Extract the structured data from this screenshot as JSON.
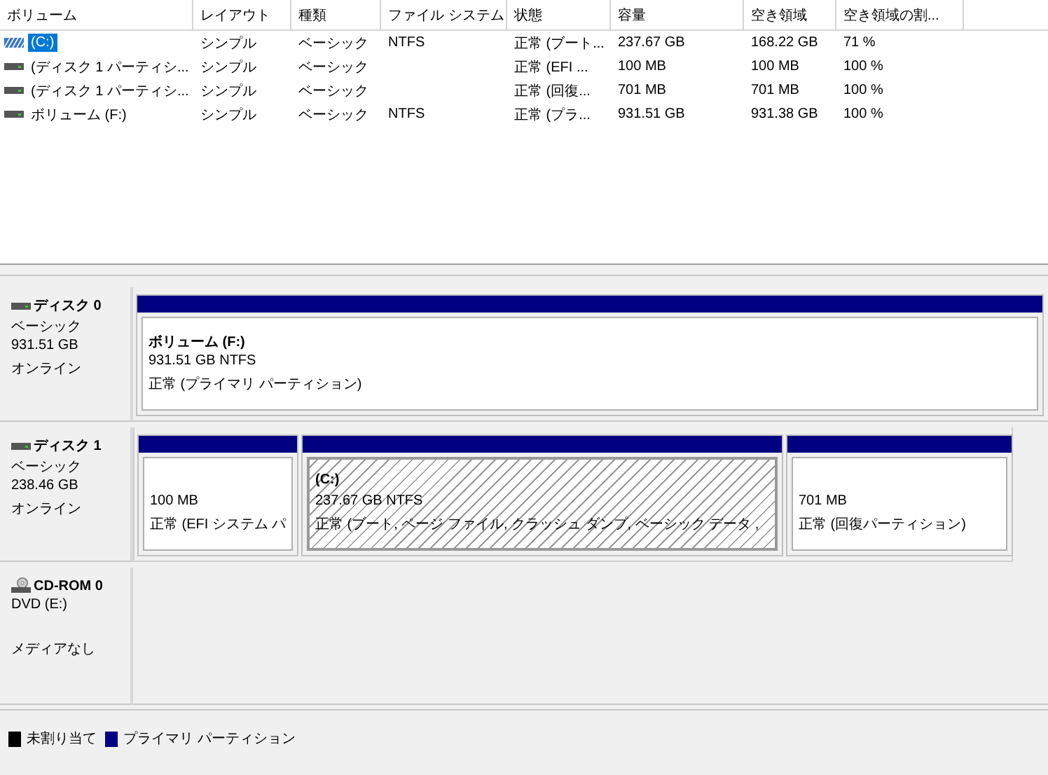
{
  "table": {
    "columns": [
      "ボリューム",
      "レイアウト",
      "種類",
      "ファイル システム",
      "状態",
      "容量",
      "空き領域",
      "空き領域の割..."
    ],
    "rows": [
      {
        "kind": "system",
        "selected": true,
        "cells": [
          "(C:)",
          "シンプル",
          "ベーシック",
          "NTFS",
          "正常 (ブート...",
          "237.67 GB",
          "168.22 GB",
          "71 %"
        ]
      },
      {
        "kind": "data",
        "selected": false,
        "cells": [
          "(ディスク 1 パーティシ...",
          "シンプル",
          "ベーシック",
          "",
          "正常 (EFI ...",
          "100 MB",
          "100 MB",
          "100 %"
        ]
      },
      {
        "kind": "data",
        "selected": false,
        "cells": [
          "(ディスク 1 パーティシ...",
          "シンプル",
          "ベーシック",
          "",
          "正常 (回復...",
          "701 MB",
          "701 MB",
          "100 %"
        ]
      },
      {
        "kind": "data",
        "selected": false,
        "cells": [
          "ボリューム (F:)",
          "シンプル",
          "ベーシック",
          "NTFS",
          "正常 (プラ...",
          "931.51 GB",
          "931.38 GB",
          "100 %"
        ]
      }
    ]
  },
  "disks": [
    {
      "kind": "disk",
      "name": "ディスク 0",
      "lines": [
        "ベーシック",
        "931.51 GB",
        "オンライン"
      ],
      "partitions": [
        {
          "title": "ボリューム  (F:)",
          "size": "931.51 GB NTFS",
          "status": "正常 (プライマリ パーティション)",
          "selected": false
        }
      ]
    },
    {
      "kind": "disk",
      "name": "ディスク 1",
      "lines": [
        "ベーシック",
        "238.46 GB",
        "オンライン"
      ],
      "partitions": [
        {
          "size": "100 MB",
          "status": "正常 (EFI システム パ",
          "selected": false
        },
        {
          "title": "(C:)",
          "size": "237.67 GB NTFS",
          "status": "正常 (ブート, ページ ファイル, クラッシュ ダンプ, ベーシック データ ,",
          "selected": true
        },
        {
          "size": "701 MB",
          "status": "正常 (回復パーティション)",
          "selected": false
        }
      ]
    },
    {
      "kind": "cdrom",
      "name": "CD-ROM 0",
      "lines": [
        "DVD (E:)",
        "メディアなし"
      ]
    }
  ],
  "legend": [
    {
      "label": "未割り当て",
      "color": "#000000"
    },
    {
      "label": "プライマリ パーティション",
      "color": "#000080"
    }
  ]
}
